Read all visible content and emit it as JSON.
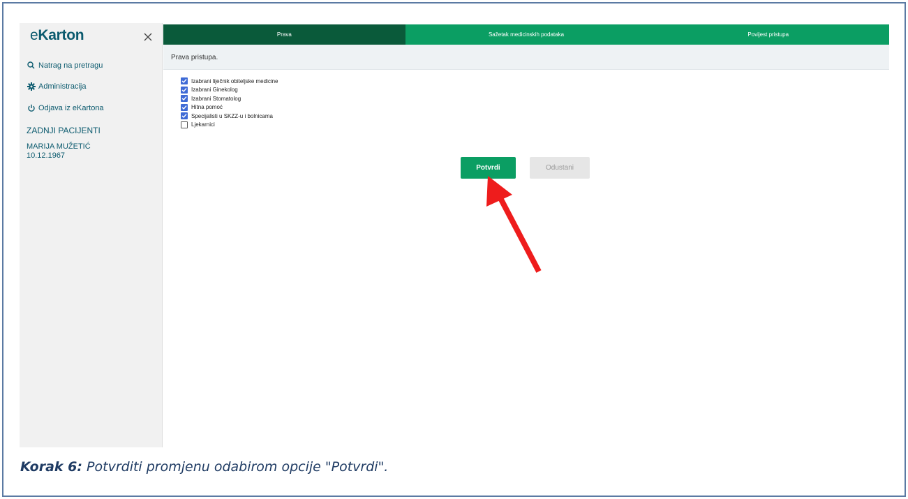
{
  "sidebar": {
    "brand_prefix": "e",
    "brand_bold": "Karton",
    "nav": [
      {
        "label": "Natrag na pretragu",
        "icon": "search-icon"
      },
      {
        "label": "Administracija",
        "icon": "gear-icon"
      },
      {
        "label": "Odjava iz eKartona",
        "icon": "power-icon"
      }
    ],
    "recent_title": "ZADNJI PACIJENTI",
    "recent_patient": {
      "name": "MARIJA MUŽETIĆ",
      "dob": "10.12.1967"
    }
  },
  "tabs": [
    {
      "label": "Prava",
      "active": true
    },
    {
      "label": "Sažetak medicinskih podataka",
      "active": false
    },
    {
      "label": "Povijest pristupa",
      "active": false
    }
  ],
  "section_title": "Prava pristupa.",
  "permissions": [
    {
      "label": "Izabrani liječnik obiteljske medicine",
      "checked": true
    },
    {
      "label": "Izabrani Ginekolog",
      "checked": true
    },
    {
      "label": "Izabrani Stomatolog",
      "checked": true
    },
    {
      "label": "Hitna pomoć",
      "checked": true
    },
    {
      "label": "Specijalisti u SKZZ-u i bolnicama",
      "checked": true
    },
    {
      "label": "Ljekarnici",
      "checked": false
    }
  ],
  "buttons": {
    "confirm": "Potvrdi",
    "cancel": "Odustani"
  },
  "caption": {
    "step": "Korak 6:",
    "text": " Potvrditi promjenu odabirom opcije \"Potvrdi\"."
  },
  "colors": {
    "accent": "#0b9e63",
    "accent_dark": "#0a5a3a",
    "arrow": "#ee1c1c",
    "frame": "#5b7aa3"
  }
}
